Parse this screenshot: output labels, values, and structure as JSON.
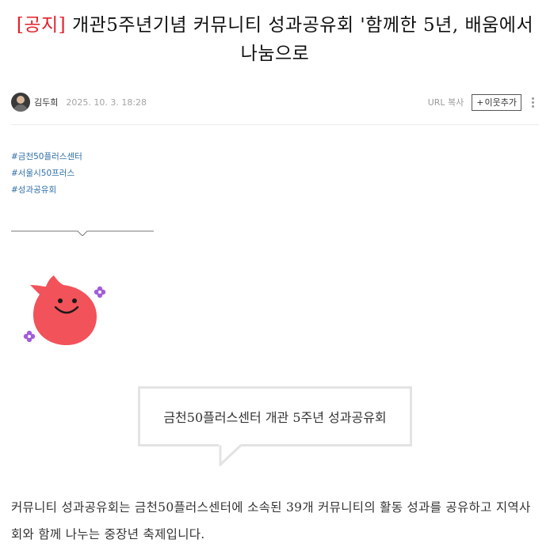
{
  "post": {
    "title_prefix": "[공지]",
    "title_text": " 개관5주년기념 커뮤니티 성과공유회 '함께한 5년, 배움에서 나눔으로"
  },
  "meta": {
    "author": "김두희",
    "date": "2025. 10. 3. 18:28",
    "url_copy_label": "URL 복사",
    "add_neighbor_plus": "+",
    "add_neighbor_label": "이웃추가"
  },
  "tags": [
    "#금천50플러스센터",
    "#서울시50프러스",
    "#성과공유회"
  ],
  "bubble": {
    "text": "금천50플러스센터 개관 5주년 성과공유회"
  },
  "body": {
    "paragraph": "커뮤니티 성과공유회는 금천50플러스센터에 소속된 39개 커뮤니티의 활동 성과를 공유하고 지역사회와 함께 나누는 중장년 축제입니다."
  },
  "colors": {
    "notice_red": "#e5202a",
    "tag_blue": "#2f6fa7",
    "mascot_red": "#f2525a",
    "flower_purple": "#a25ddb"
  },
  "icons": {
    "more": "more-vertical-icon",
    "avatar": "avatar"
  }
}
